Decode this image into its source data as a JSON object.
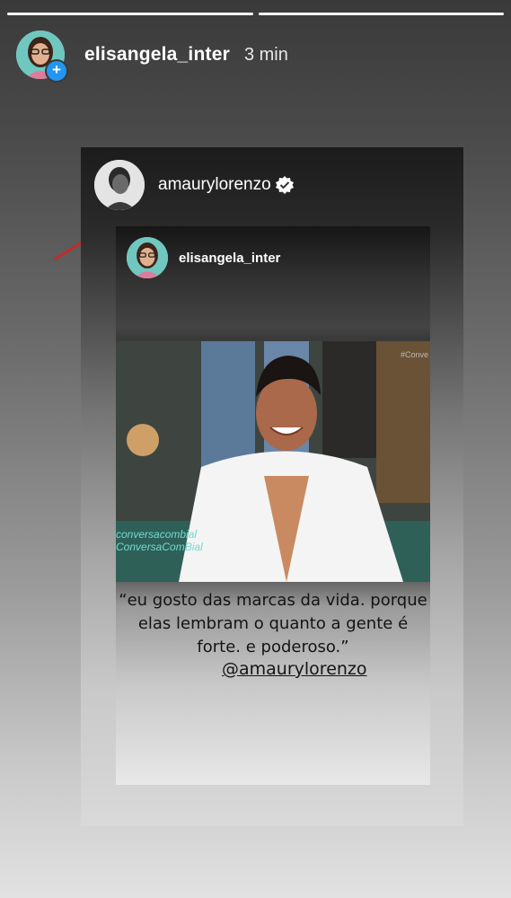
{
  "story": {
    "username": "elisangela_inter",
    "time": "3 min",
    "add_icon": "plus-icon"
  },
  "shared_post": {
    "username": "amaurylorenzo",
    "verified_icon": "verified-badge-icon"
  },
  "inner_post": {
    "username": "elisangela_inter",
    "watermark_line1": "conversacombial",
    "watermark_line2": "ConversaComBial",
    "tag": "#Conve",
    "quote": "“eu gosto das marcas da vida. porque elas lembram o quanto a gente é forte. e poderoso.”",
    "mention": "@amaurylorenzo"
  },
  "colors": {
    "accent_blue": "#2196f3",
    "watermark_cyan": "#6fdad0"
  }
}
